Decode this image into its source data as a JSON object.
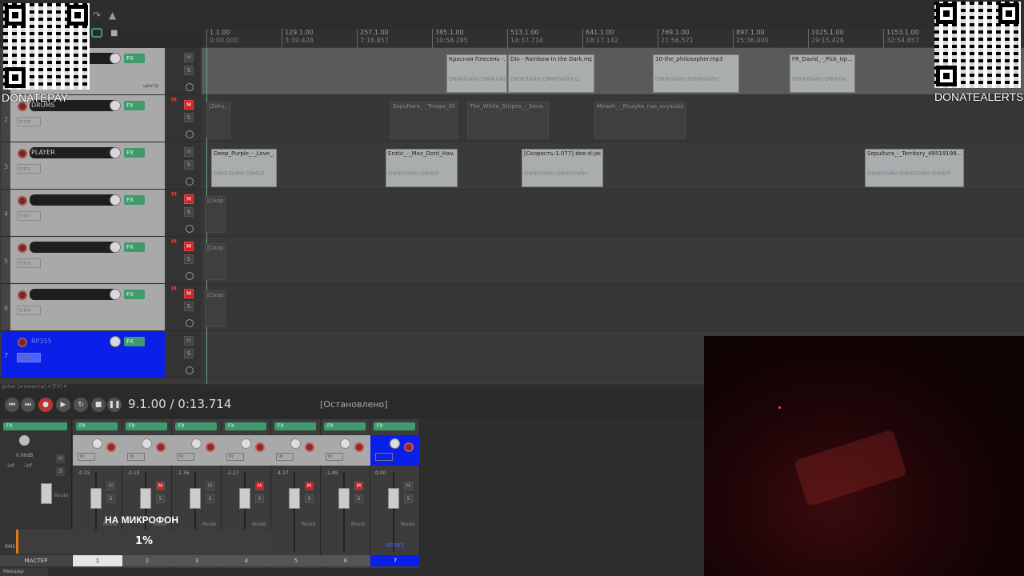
{
  "overlays": {
    "donate_left": "DONATEPAY",
    "donate_right": "DONATEALERTS",
    "mic_label": "НА МИКРОФОН",
    "progress_text": "1%",
    "progress_value": 0.01
  },
  "ruler": [
    {
      "bar": "1.1.00",
      "time": "0:00.000"
    },
    {
      "bar": "129.1.00",
      "time": "3:39.428"
    },
    {
      "bar": "257.1.00",
      "time": "7:18.857"
    },
    {
      "bar": "385.1.00",
      "time": "10:58.285"
    },
    {
      "bar": "513.1.00",
      "time": "14:37.714"
    },
    {
      "bar": "641.1.00",
      "time": "18:17.142"
    },
    {
      "bar": "769.1.00",
      "time": "21:56.571"
    },
    {
      "bar": "897.1.00",
      "time": "25:36.000"
    },
    {
      "bar": "1025.1.00",
      "time": "29:15.428"
    },
    {
      "bar": "1153.1.00",
      "time": "32:54.857"
    }
  ],
  "tracks": [
    {
      "num": "",
      "name": "",
      "label2": "центр",
      "mute": false
    },
    {
      "num": "2",
      "name": "DRUMS",
      "trim": "trim",
      "mute": true
    },
    {
      "num": "3",
      "name": "PLAYER",
      "trim": "trim",
      "mute": false
    },
    {
      "num": "4",
      "name": "",
      "trim": "trim",
      "mute": true
    },
    {
      "num": "5",
      "name": "",
      "trim": "trim",
      "mute": true
    },
    {
      "num": "6",
      "name": "",
      "trim": "trim",
      "mute": true
    },
    {
      "num": "7",
      "name": "RP355",
      "trim": "trim",
      "mute": false
    }
  ],
  "buttons": {
    "fx": "FX",
    "m": "M",
    "s": "S"
  },
  "items": {
    "lane1": [
      {
        "label": "Красная Плесень -...",
        "off": "ОФФЛАЙН   ОФФЛАЙН"
      },
      {
        "label": "Dio - Rainbow In the Dark.mp3",
        "off": "ОФФЛАЙН   ОФФЛАЙН   О"
      },
      {
        "label": "10-the_philosopher.mp3",
        "off": "ОФФЛАЙН   ОФФЛАЙН"
      },
      {
        "label": "FR_David_-_Pick_Up...",
        "off": "ОФФЛАЙН   ОФФЛА"
      }
    ],
    "lane2": [
      {
        "label": "[Zdru..."
      },
      {
        "label": "Sepultura_-_Troops_Of..."
      },
      {
        "label": "The_White_Stripes_-_Seve..."
      },
      {
        "label": "Mirazh_-_Muzyka_nas_svyazala..."
      }
    ],
    "lane3": [
      {
        "label": "Deep_Purple_-_Love_...",
        "off": "ОФФЛАЙН   ОФФЛ"
      },
      {
        "label": "Erotic_-_Max_Dont_Hav...",
        "off": "ОФФЛАЙН   ОФФЛ"
      },
      {
        "label": "[Скорость:1.077] dee-d-jac...",
        "off": "ОФФЛАЙН   ОФФЛАЙН"
      },
      {
        "label": "Sepultura_-_Territory_49519198...",
        "off": "ОФФЛАЙН   ОФФЛАЙН   ОФФЛ"
      }
    ],
    "lane4": [
      {
        "label": "[Скор..."
      }
    ],
    "lane5": [
      {
        "label": "[Скор..."
      }
    ],
    "lane6": [
      {
        "label": "[Скор..."
      }
    ]
  },
  "transport": {
    "time": "9.1.00 / 0:13.714",
    "status": "[Остановлено]",
    "status_line": "guitar [элементы] 4 [FX] 4"
  },
  "mixer": {
    "master_label": "МАСТЕР",
    "master_db": "0.00dB",
    "master_inf1": "-inf",
    "master_inf2": "-inf",
    "rms": "RMS",
    "tab": "Микшер",
    "strips": [
      {
        "db": "-0.15",
        "num": "1",
        "mute": false,
        "name": ""
      },
      {
        "db": "-0.19",
        "num": "2",
        "mute": true,
        "name": ""
      },
      {
        "db": "-1.36",
        "num": "3",
        "mute": false,
        "name": ""
      },
      {
        "db": "-2.27",
        "num": "4",
        "mute": true,
        "name": ""
      },
      {
        "db": "-4.27",
        "num": "5",
        "mute": true,
        "name": ""
      },
      {
        "db": "-1.89",
        "num": "6",
        "mute": true,
        "name": ""
      },
      {
        "db": "0.00",
        "num": "7",
        "mute": false,
        "name": "RP355"
      }
    ],
    "in_label": "in",
    "route_label": "Route"
  },
  "colors": {
    "selected_track": "#0a1fe8",
    "fx_green": "#3f9b6e",
    "mute_red": "#cc2222",
    "progress": "#e07a12"
  }
}
